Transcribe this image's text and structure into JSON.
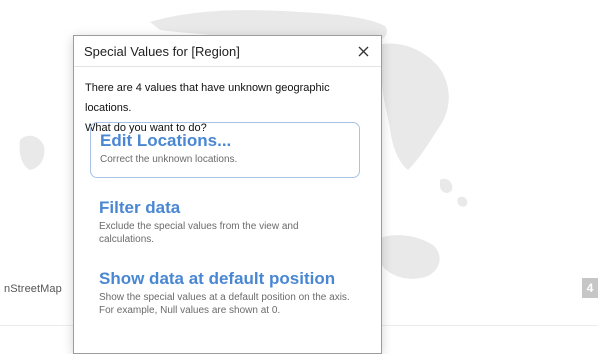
{
  "map": {
    "attribution": "nStreetMap",
    "count_badge": "4"
  },
  "dialog": {
    "title": "Special Values for [Region]",
    "close_symbol": "×",
    "message_line1": "There are 4 values that have unknown geographic locations.",
    "message_line2": "What do you want to do?",
    "options": [
      {
        "title": "Edit Locations...",
        "description": "Correct the unknown locations.",
        "selected": true
      },
      {
        "title": "Filter data",
        "description": "Exclude the special values from the view and calculations.",
        "selected": false
      },
      {
        "title": "Show data at default position",
        "description": "Show the special values at a default position on the axis. For example, Null values are shown at 0.",
        "selected": false
      }
    ]
  },
  "colors": {
    "accent": "#4a87d3",
    "map_land": "#e6e6e6",
    "badge": "#c6c6c6"
  }
}
